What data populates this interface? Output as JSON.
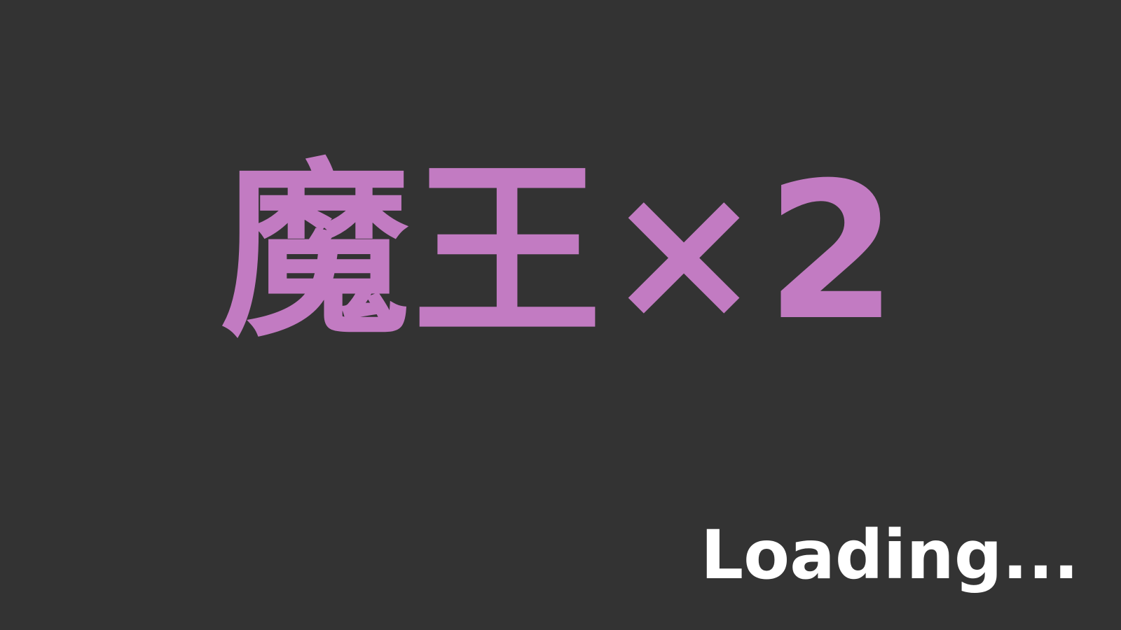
{
  "title": {
    "text": "魔王×2",
    "color": "#c27bc2"
  },
  "loading": {
    "text": "Loading...",
    "color": "#ffffff"
  },
  "background_color": "#333333"
}
